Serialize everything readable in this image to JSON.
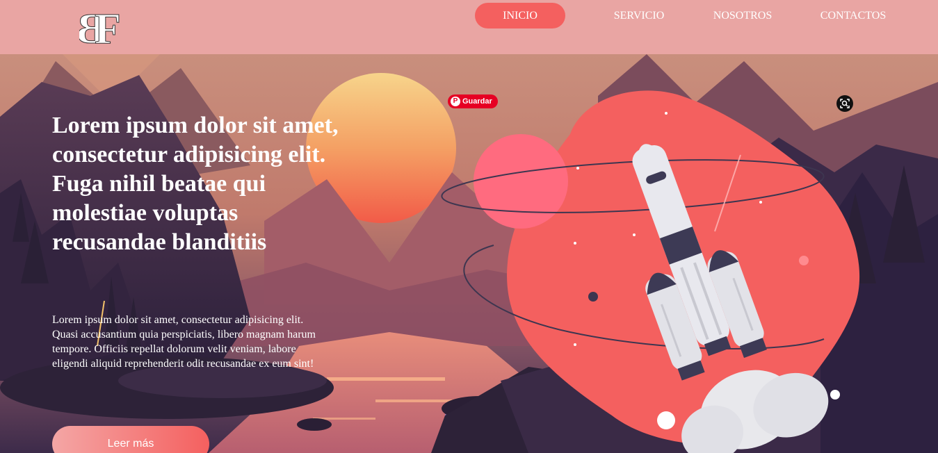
{
  "logo": {
    "text": "BF",
    "icon": "bf-monogram-logo"
  },
  "nav": {
    "items": [
      {
        "label": "INICIO",
        "active": true
      },
      {
        "label": "SERVICIO",
        "active": false
      },
      {
        "label": "NOSOTROS",
        "active": false
      },
      {
        "label": "CONTACTOS",
        "active": false
      }
    ]
  },
  "hero": {
    "headline": "Lorem ipsum dolor sit amet, consectetur adipisicing elit. Fuga nihil beatae qui molestiae voluptas recusandae blanditiis",
    "paragraph": "Lorem ipsum dolor sit amet, consectetur adipisicing elit. Quasi accusantium quia perspiciatis, libero magnam harum tempore. Officiis repellat dolorum velit veniam, labore eligendi aliquid reprehenderit odit recusandae ex eum sint!",
    "cta_label": "Leer más"
  },
  "overlay": {
    "pinterest_label": "Guardar",
    "pinterest_icon": "pinterest-icon",
    "lens_icon": "visual-search-icon"
  },
  "colors": {
    "header_bg": "#e9a5a3",
    "accent": "#f4605f",
    "blob": "#f4605f",
    "planet": "#ff6b7f"
  }
}
